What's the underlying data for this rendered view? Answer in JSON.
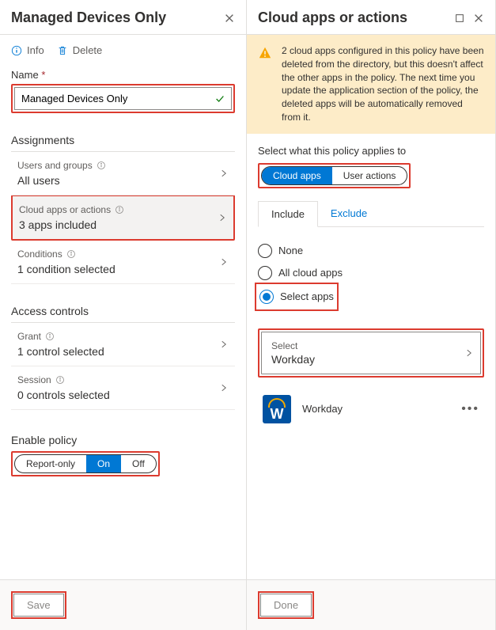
{
  "left": {
    "title": "Managed Devices Only",
    "toolbar": {
      "info": "Info",
      "delete": "Delete"
    },
    "nameLabel": "Name",
    "nameValue": "Managed Devices Only",
    "sections": {
      "assignmentsTitle": "Assignments",
      "accessControlsTitle": "Access controls"
    },
    "rows": {
      "users": {
        "label": "Users and groups",
        "value": "All users"
      },
      "apps": {
        "label": "Cloud apps or actions",
        "value": "3 apps included"
      },
      "conditions": {
        "label": "Conditions",
        "value": "1 condition selected"
      },
      "grant": {
        "label": "Grant",
        "value": "1 control selected"
      },
      "session": {
        "label": "Session",
        "value": "0 controls selected"
      }
    },
    "enablePolicyLabel": "Enable policy",
    "enablePills": {
      "report": "Report-only",
      "on": "On",
      "off": "Off"
    },
    "saveBtn": "Save"
  },
  "right": {
    "title": "Cloud apps or actions",
    "warning": "2 cloud apps configured in this policy have been deleted from the directory, but this doesn't affect the other apps in the policy. The next time you update the application section of the policy, the deleted apps will be automatically removed from it.",
    "appliesLabel": "Select what this policy applies to",
    "pills": {
      "cloud": "Cloud apps",
      "user": "User actions"
    },
    "tabs": {
      "include": "Include",
      "exclude": "Exclude"
    },
    "radios": {
      "none": "None",
      "all": "All cloud apps",
      "select": "Select apps"
    },
    "select": {
      "label": "Select",
      "value": "Workday"
    },
    "app": {
      "name": "Workday",
      "letter": "W"
    },
    "doneBtn": "Done"
  }
}
